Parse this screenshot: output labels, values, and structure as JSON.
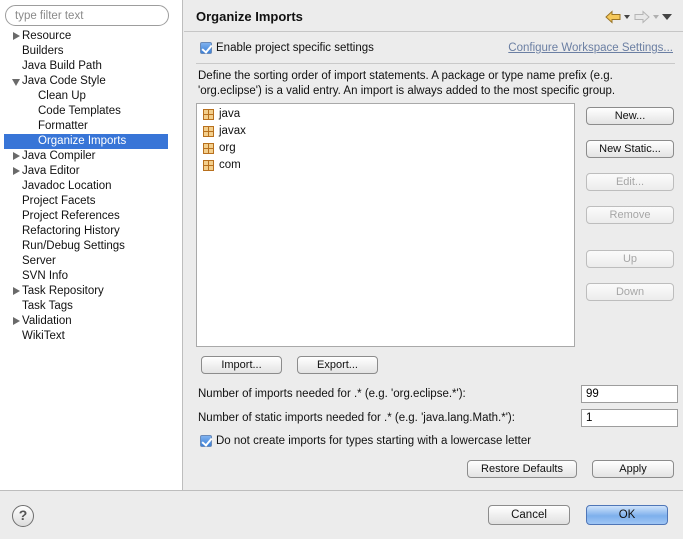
{
  "sidebar": {
    "filter_placeholder": "type filter text",
    "items": [
      {
        "label": "Resource",
        "level": 0,
        "expander": "collapsed"
      },
      {
        "label": "Builders",
        "level": 0,
        "expander": "none"
      },
      {
        "label": "Java Build Path",
        "level": 0,
        "expander": "none"
      },
      {
        "label": "Java Code Style",
        "level": 0,
        "expander": "expanded"
      },
      {
        "label": "Clean Up",
        "level": 1,
        "expander": "none"
      },
      {
        "label": "Code Templates",
        "level": 1,
        "expander": "none"
      },
      {
        "label": "Formatter",
        "level": 1,
        "expander": "none"
      },
      {
        "label": "Organize Imports",
        "level": 1,
        "expander": "none",
        "selected": true
      },
      {
        "label": "Java Compiler",
        "level": 0,
        "expander": "collapsed"
      },
      {
        "label": "Java Editor",
        "level": 0,
        "expander": "collapsed"
      },
      {
        "label": "Javadoc Location",
        "level": 0,
        "expander": "none"
      },
      {
        "label": "Project Facets",
        "level": 0,
        "expander": "none"
      },
      {
        "label": "Project References",
        "level": 0,
        "expander": "none"
      },
      {
        "label": "Refactoring History",
        "level": 0,
        "expander": "none"
      },
      {
        "label": "Run/Debug Settings",
        "level": 0,
        "expander": "none"
      },
      {
        "label": "Server",
        "level": 0,
        "expander": "none"
      },
      {
        "label": "SVN Info",
        "level": 0,
        "expander": "none"
      },
      {
        "label": "Task Repository",
        "level": 0,
        "expander": "collapsed"
      },
      {
        "label": "Task Tags",
        "level": 0,
        "expander": "none"
      },
      {
        "label": "Validation",
        "level": 0,
        "expander": "collapsed"
      },
      {
        "label": "WikiText",
        "level": 0,
        "expander": "none"
      }
    ]
  },
  "header": {
    "title": "Organize Imports",
    "nav_icons": [
      "back-arrow-icon",
      "forward-arrow-icon",
      "view-menu-icon"
    ]
  },
  "settings": {
    "enable_label": "Enable project specific settings",
    "enable_checked": true,
    "configure_link": "Configure Workspace Settings...",
    "description": "Define the sorting order of import statements. A package or type name prefix (e.g. 'org.eclipse') is a valid entry. An import is always added to the most specific group."
  },
  "imports": {
    "entries": [
      "java",
      "javax",
      "org",
      "com"
    ],
    "icon": "package-icon"
  },
  "buttons": {
    "new": "New...",
    "new_static": "New Static...",
    "edit": "Edit...",
    "remove": "Remove",
    "up": "Up",
    "down": "Down",
    "import": "Import...",
    "export": "Export...",
    "restore_defaults": "Restore Defaults",
    "apply": "Apply",
    "cancel": "Cancel",
    "ok": "OK"
  },
  "thresholds": {
    "imports_label": "Number of imports needed for .* (e.g. 'org.eclipse.*'):",
    "imports_value": "99",
    "static_label": "Number of static imports needed for .* (e.g. 'java.lang.Math.*'):",
    "static_value": "1"
  },
  "lowercase": {
    "label": "Do not create imports for types starting with a lowercase letter",
    "checked": true
  },
  "help": {
    "glyph": "?"
  }
}
